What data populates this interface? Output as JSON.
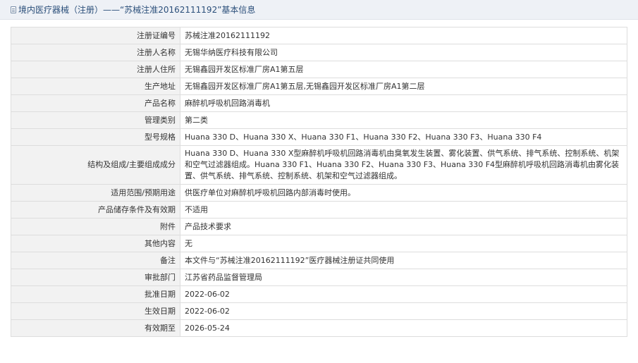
{
  "header": {
    "title": "境内医疗器械（注册）——“苏械注准20162111192”基本信息"
  },
  "rows": [
    {
      "label": "注册证编号",
      "value": "苏械注准20162111192"
    },
    {
      "label": "注册人名称",
      "value": "无锡华纳医疗科技有限公司"
    },
    {
      "label": "注册人住所",
      "value": "无锡鑫园开发区标准厂房A1第五层"
    },
    {
      "label": "生产地址",
      "value": "无锡鑫园开发区标准厂房A1第五层,无锡鑫园开发区标准厂房A1第二层"
    },
    {
      "label": "产品名称",
      "value": "麻醉机呼吸机回路消毒机"
    },
    {
      "label": "管理类别",
      "value": "第二类"
    },
    {
      "label": "型号规格",
      "value": "Huana 330 D、Huana 330 X、Huana 330 F1、Huana 330 F2、Huana 330 F3、Huana 330 F4"
    },
    {
      "label": "结构及组成/主要组成成分",
      "value": "Huana 330 D、Huana 330 X型麻醉机呼吸机回路消毒机由臭氧发生装置、雾化装置、供气系统、排气系统、控制系统、机架和空气过滤器组成。Huana 330 F1、Huana 330 F2、Huana 330 F3、Huana 330 F4型麻醉机呼吸机回路消毒机由雾化装置、供气系统、排气系统、控制系统、机架和空气过滤器组成。"
    },
    {
      "label": "适用范围/预期用途",
      "value": "供医疗单位对麻醉机呼吸机回路内部消毒时使用。"
    },
    {
      "label": "产品储存条件及有效期",
      "value": "不适用"
    },
    {
      "label": "附件",
      "value": "产品技术要求"
    },
    {
      "label": "其他内容",
      "value": "无"
    },
    {
      "label": "备注",
      "value": "本文件与“苏械注准20162111192”医疗器械注册证共同使用"
    },
    {
      "label": "审批部门",
      "value": "江苏省药品监督管理局"
    },
    {
      "label": "批准日期",
      "value": "2022-06-02"
    },
    {
      "label": "生效日期",
      "value": "2022-06-02"
    },
    {
      "label": "有效期至",
      "value": "2026-05-24"
    }
  ]
}
